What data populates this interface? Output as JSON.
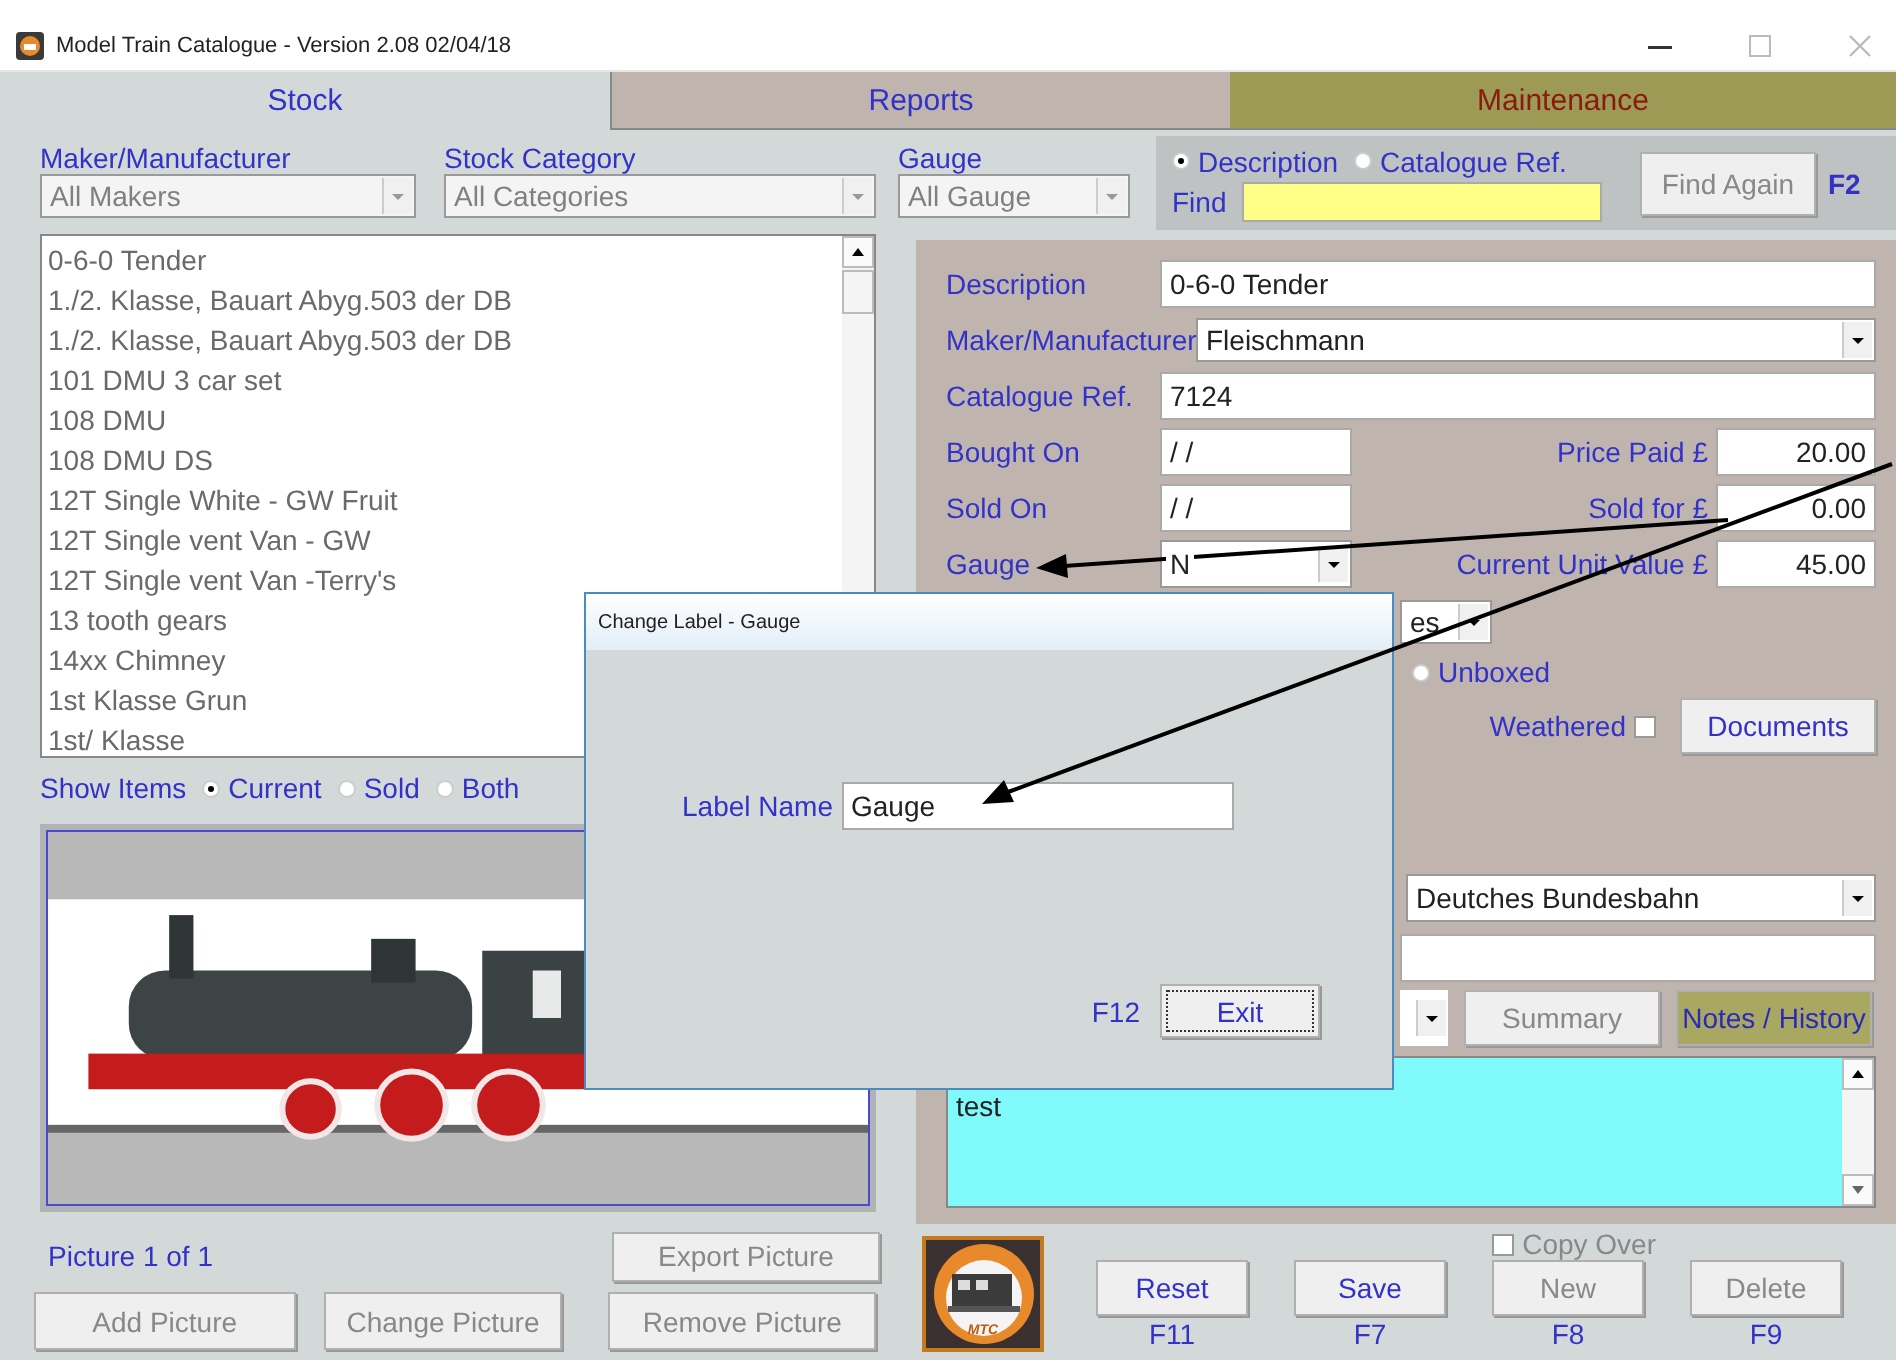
{
  "window": {
    "title": "Model Train Catalogue -  Version 2.08  02/04/18"
  },
  "tabs": [
    {
      "label": "Stock",
      "selected": true
    },
    {
      "label": "Reports",
      "selected": false
    },
    {
      "label": "Maintenance",
      "selected": false
    }
  ],
  "filters": [
    {
      "label": "Maker/Manufacturer",
      "value": "All Makers"
    },
    {
      "label": "Stock Category",
      "value": "All Categories"
    },
    {
      "label": "Gauge",
      "value": "All Gauge"
    }
  ],
  "find": {
    "options": [
      {
        "label": "Description",
        "selected": true
      },
      {
        "label": "Catalogue Ref.",
        "selected": false
      }
    ],
    "label": "Find",
    "button": "Find Again",
    "shortcut": "F2"
  },
  "items": [
    "0-6-0 Tender",
    "1./2. Klasse, Bauart Abyg.503 der DB",
    "1./2. Klasse, Bauart Abyg.503 der DB",
    "101 DMU 3 car set",
    "108 DMU",
    "108 DMU DS",
    "12T Single White - GW Fruit",
    "12T Single vent Van - GW",
    "12T Single vent Van -Terry's",
    "13 tooth gears",
    "14xx Chimney",
    "1st Klasse Grun",
    "1st/ Klasse"
  ],
  "show_items": {
    "label": "Show Items",
    "options": [
      {
        "label": "Current",
        "selected": true
      },
      {
        "label": "Sold",
        "selected": false
      },
      {
        "label": "Both",
        "selected": false
      }
    ]
  },
  "picture": {
    "kind": "picture",
    "caption": "Picture 1 of 1"
  },
  "export_button": {
    "label": "Export Picture",
    "disabled": true
  },
  "picture_buttons": [
    {
      "label": "Add Picture",
      "disabled": true
    },
    {
      "label": "Change Picture",
      "disabled": true
    },
    {
      "label": "Remove Picture",
      "disabled": true
    }
  ],
  "form": {
    "fields": [
      {
        "kind": "text",
        "label": "Description",
        "value": "0-6-0 Tender"
      },
      {
        "kind": "combo",
        "label": "Maker/Manufacturer",
        "value": "Fleischmann"
      },
      {
        "kind": "text",
        "label": "Catalogue Ref.",
        "value": "7124"
      }
    ],
    "rows": [
      {
        "label": "Bought On",
        "kind": "text",
        "value": "/ /",
        "price_label": "Price Paid £",
        "price": "20.00"
      },
      {
        "label": "Sold On",
        "kind": "text",
        "value": "/ /",
        "price_label": "Sold for £",
        "price": "0.00"
      },
      {
        "label": "Gauge",
        "kind": "combo",
        "value": "N",
        "price_label": "Current Unit Value £",
        "price": "45.00"
      }
    ],
    "partial_combo": {
      "value": "es"
    },
    "unboxed": {
      "label": "Unboxed",
      "selected": false
    },
    "weathered": {
      "label": "Weathered",
      "checked": false
    },
    "documents_button": {
      "label": "Documents",
      "disabled": false
    },
    "railway": {
      "value": "Deutches Bundesbahn"
    },
    "summary_button": {
      "label": "Summary",
      "disabled": true
    },
    "notes_button": {
      "label": "Notes / History",
      "selected": true
    },
    "notes": {
      "text": "test"
    }
  },
  "copy_over": {
    "label": "Copy Over",
    "checked": false
  },
  "logo": {
    "text": "MTC"
  },
  "actions": [
    {
      "label": "Reset",
      "key": "F11",
      "disabled": false
    },
    {
      "label": "Save",
      "key": "F7",
      "disabled": false
    },
    {
      "label": "New",
      "key": "F8",
      "disabled": true
    },
    {
      "label": "Delete",
      "key": "F9",
      "disabled": true
    }
  ],
  "dialog": {
    "title": "Change Label - Gauge",
    "label": "Label Name",
    "value": "Gauge",
    "shortcut": "F12",
    "button": "Exit"
  }
}
